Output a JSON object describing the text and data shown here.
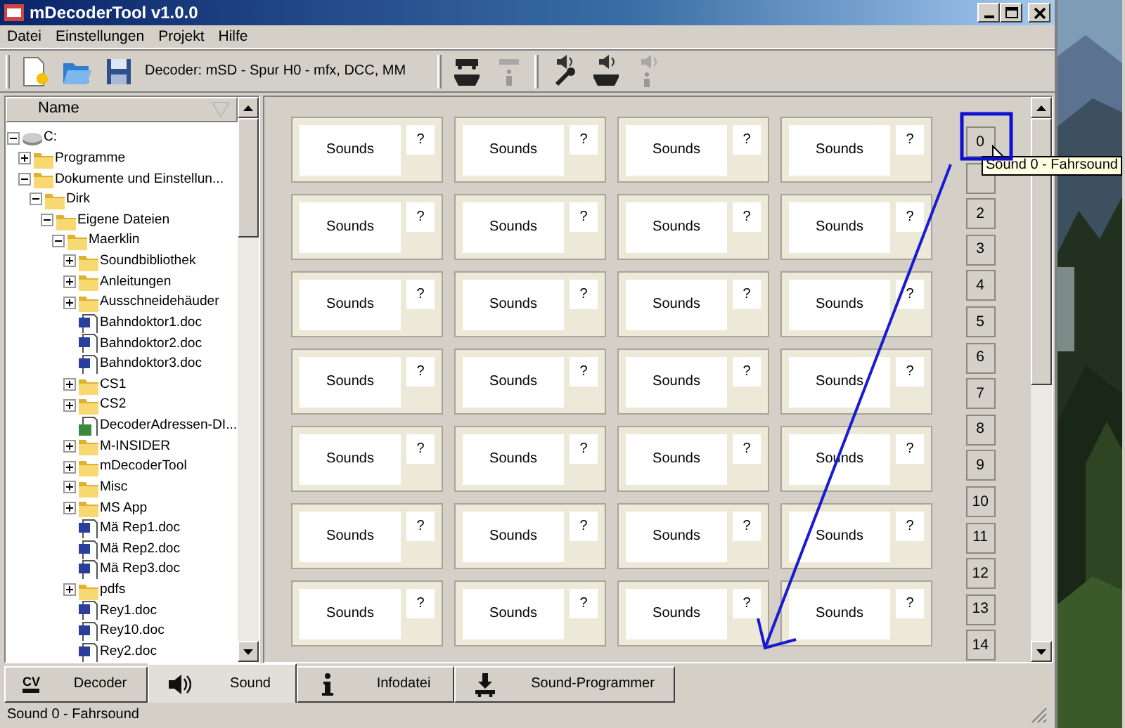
{
  "window": {
    "title": "mDecoderTool v1.0.0"
  },
  "menu": [
    "Datei",
    "Einstellungen",
    "Projekt",
    "Hilfe"
  ],
  "toolbar": {
    "file_buttons": [
      {
        "kind": "new"
      },
      {
        "kind": "open"
      },
      {
        "kind": "save"
      }
    ],
    "decoder_info": "Decoder: mSD - Spur H0 - mfx, DCC, MM",
    "decoder_tools": [
      {
        "kind": "loco-read",
        "disabled": false
      },
      {
        "kind": "loco-info",
        "disabled": true
      }
    ],
    "sound_tools": [
      {
        "kind": "speaker-wrench",
        "disabled": false
      },
      {
        "kind": "speaker-loco",
        "disabled": false
      },
      {
        "kind": "speaker-info",
        "disabled": true
      }
    ]
  },
  "tree": {
    "column": "Name",
    "items": [
      {
        "label": "C:",
        "kind": "drive",
        "expanded": true,
        "children": [
          {
            "label": "Programme",
            "kind": "folder",
            "expanded": false
          },
          {
            "label": "Dokumente und Einstellun...",
            "kind": "folder",
            "expanded": true,
            "children": [
              {
                "label": "Dirk",
                "kind": "folder",
                "expanded": true,
                "children": [
                  {
                    "label": "Eigene Dateien",
                    "kind": "folder",
                    "expanded": true,
                    "children": [
                      {
                        "label": "Maerklin",
                        "kind": "folder",
                        "expanded": true,
                        "children": [
                          {
                            "label": "Soundbibliothek",
                            "kind": "folder",
                            "expanded": false
                          },
                          {
                            "label": "Anleitungen",
                            "kind": "folder",
                            "expanded": false
                          },
                          {
                            "label": "Ausschneidehäuder",
                            "kind": "folder",
                            "expanded": false
                          },
                          {
                            "label": "Bahndoktor1.doc",
                            "kind": "doc"
                          },
                          {
                            "label": "Bahndoktor2.doc",
                            "kind": "doc"
                          },
                          {
                            "label": "Bahndoktor3.doc",
                            "kind": "doc"
                          },
                          {
                            "label": "CS1",
                            "kind": "folder",
                            "expanded": false
                          },
                          {
                            "label": "CS2",
                            "kind": "folder",
                            "expanded": false
                          },
                          {
                            "label": "DecoderAdressen-DI...",
                            "kind": "sheet"
                          },
                          {
                            "label": "M-INSIDER",
                            "kind": "folder",
                            "expanded": false
                          },
                          {
                            "label": "mDecoderTool",
                            "kind": "folder",
                            "expanded": false
                          },
                          {
                            "label": "Misc",
                            "kind": "folder",
                            "expanded": false
                          },
                          {
                            "label": "MS App",
                            "kind": "folder",
                            "expanded": false
                          },
                          {
                            "label": "Mä Rep1.doc",
                            "kind": "doc"
                          },
                          {
                            "label": "Mä Rep2.doc",
                            "kind": "doc"
                          },
                          {
                            "label": "Mä Rep3.doc",
                            "kind": "doc"
                          },
                          {
                            "label": "pdfs",
                            "kind": "folder",
                            "expanded": false
                          },
                          {
                            "label": "Rey1.doc",
                            "kind": "doc"
                          },
                          {
                            "label": "Rey10.doc",
                            "kind": "doc"
                          },
                          {
                            "label": "Rey2.doc",
                            "kind": "doc"
                          }
                        ]
                      }
                    ]
                  }
                ]
              }
            ]
          }
        ]
      }
    ]
  },
  "sound_grid": {
    "rows": [
      [
        {
          "label": "Sounds",
          "help": "?"
        },
        {
          "label": "Sounds",
          "help": "?"
        },
        {
          "label": "Sounds",
          "help": "?"
        },
        {
          "label": "Sounds",
          "help": "?"
        }
      ],
      [
        {
          "label": "Sounds",
          "help": "?"
        },
        {
          "label": "Sounds",
          "help": "?"
        },
        {
          "label": "Sounds",
          "help": "?"
        },
        {
          "label": "Sounds",
          "help": "?"
        }
      ],
      [
        {
          "label": "Sounds",
          "help": "?"
        },
        {
          "label": "Sounds",
          "help": "?"
        },
        {
          "label": "Sounds",
          "help": "?"
        },
        {
          "label": "Sounds",
          "help": "?"
        }
      ],
      [
        {
          "label": "Sounds",
          "help": "?"
        },
        {
          "label": "Sounds",
          "help": "?"
        },
        {
          "label": "Sounds",
          "help": "?"
        },
        {
          "label": "Sounds",
          "help": "?"
        }
      ],
      [
        {
          "label": "Sounds",
          "help": "?"
        },
        {
          "label": "Sounds",
          "help": "?"
        },
        {
          "label": "Sounds",
          "help": "?"
        },
        {
          "label": "Sounds",
          "help": "?"
        }
      ],
      [
        {
          "label": "Sounds",
          "help": "?"
        },
        {
          "label": "Sounds",
          "help": "?"
        },
        {
          "label": "Sounds",
          "help": "?"
        },
        {
          "label": "Sounds",
          "help": "?"
        }
      ],
      [
        {
          "label": "Sounds",
          "help": "?"
        },
        {
          "label": "Sounds",
          "help": "?"
        },
        {
          "label": "Sounds",
          "help": "?"
        },
        {
          "label": "Sounds",
          "help": "?"
        }
      ]
    ]
  },
  "slot_buttons": [
    {
      "label": "0",
      "covered": false
    },
    {
      "covered": true
    },
    {
      "label": "2",
      "covered": false
    },
    {
      "label": "3",
      "covered": false
    },
    {
      "label": "4",
      "covered": false
    },
    {
      "label": "5",
      "covered": false
    },
    {
      "label": "6",
      "covered": false
    },
    {
      "label": "7",
      "covered": false
    },
    {
      "label": "8",
      "covered": false
    },
    {
      "label": "9",
      "covered": false
    },
    {
      "label": "10",
      "covered": false
    },
    {
      "label": "11",
      "covered": false
    },
    {
      "label": "12",
      "covered": false
    },
    {
      "label": "13",
      "covered": false
    },
    {
      "label": "14",
      "covered": false
    }
  ],
  "tooltip": "Sound 0 - Fahrsound",
  "tabs": [
    {
      "label": "Decoder",
      "kind": "cv",
      "icon_text": "CV",
      "selected": false
    },
    {
      "label": "Sound",
      "kind": "speaker",
      "selected": true
    },
    {
      "label": "Infodatei",
      "kind": "info",
      "selected": false
    },
    {
      "label": "Sound-Programmer",
      "kind": "programmer",
      "selected": false
    }
  ],
  "status_bar": "Sound 0 - Fahrsound"
}
